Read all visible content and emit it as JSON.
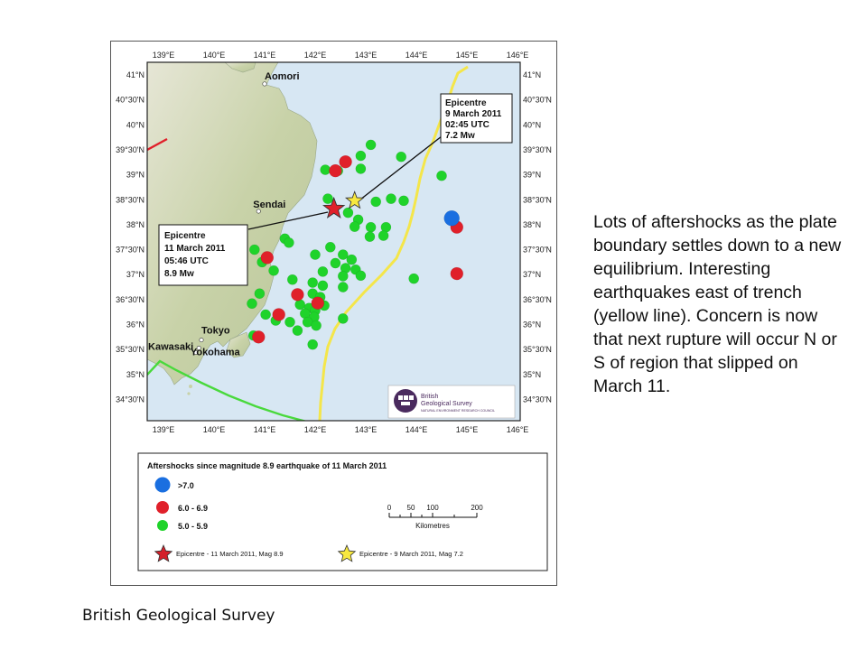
{
  "map": {
    "lon_labels": [
      "139°E",
      "140°E",
      "141°E",
      "142°E",
      "143°E",
      "144°E",
      "145°E",
      "146°E"
    ],
    "lat_labels": [
      "41°N",
      "40°30'N",
      "40°N",
      "39°30'N",
      "39°N",
      "38°30'N",
      "38°N",
      "37°30'N",
      "37°N",
      "36°30'N",
      "36°N",
      "35°30'N",
      "35°N",
      "34°30'N"
    ],
    "cities": [
      {
        "name": "Aomori",
        "lon": 141.0,
        "lat": 40.82
      },
      {
        "name": "Sendai",
        "lon": 140.88,
        "lat": 38.27
      },
      {
        "name": "Tokyo",
        "lon": 139.75,
        "lat": 35.69
      },
      {
        "name": "Yokohama",
        "lon": 139.64,
        "lat": 35.44
      },
      {
        "name": "Kawasaki",
        "lon": 139.7,
        "lat": 35.53
      }
    ],
    "callouts": [
      {
        "lines": [
          "Epicentre",
          "9 March 2011",
          "02:45 UTC",
          "7.2 Mw"
        ]
      },
      {
        "lines": [
          "Epicentre",
          "11 March 2011",
          "05:46 UTC",
          "8.9 Mw"
        ]
      }
    ],
    "epicentres": [
      {
        "name": "11 March 2011",
        "lon": 142.37,
        "lat": 38.32,
        "color": "#e0202a"
      },
      {
        "name": "9 March 2011",
        "lon": 142.78,
        "lat": 38.48,
        "color": "#f7e840"
      }
    ],
    "aftershocks": [
      {
        "lon": 144.7,
        "lat": 38.13,
        "cls": "blue"
      },
      {
        "lon": 144.8,
        "lat": 37.95,
        "cls": "red"
      },
      {
        "lon": 144.8,
        "lat": 37.02,
        "cls": "red"
      },
      {
        "lon": 141.05,
        "lat": 37.34,
        "cls": "red"
      },
      {
        "lon": 142.6,
        "lat": 39.26,
        "cls": "red"
      },
      {
        "lon": 142.4,
        "lat": 39.08,
        "cls": "red"
      },
      {
        "lon": 141.65,
        "lat": 36.6,
        "cls": "red"
      },
      {
        "lon": 142.05,
        "lat": 36.43,
        "cls": "red"
      },
      {
        "lon": 141.28,
        "lat": 36.2,
        "cls": "red"
      },
      {
        "lon": 140.88,
        "lat": 35.75,
        "cls": "red"
      },
      {
        "lon": 143.1,
        "lat": 39.6,
        "cls": "green"
      },
      {
        "lon": 142.9,
        "lat": 39.38,
        "cls": "green"
      },
      {
        "lon": 143.7,
        "lat": 39.36,
        "cls": "green"
      },
      {
        "lon": 142.9,
        "lat": 39.12,
        "cls": "green"
      },
      {
        "lon": 142.2,
        "lat": 39.1,
        "cls": "green"
      },
      {
        "lon": 142.45,
        "lat": 39.08,
        "cls": "green"
      },
      {
        "lon": 142.25,
        "lat": 38.52,
        "cls": "green"
      },
      {
        "lon": 143.2,
        "lat": 38.46,
        "cls": "green"
      },
      {
        "lon": 143.5,
        "lat": 38.52,
        "cls": "green"
      },
      {
        "lon": 143.75,
        "lat": 38.48,
        "cls": "green"
      },
      {
        "lon": 144.5,
        "lat": 38.98,
        "cls": "green"
      },
      {
        "lon": 142.65,
        "lat": 38.24,
        "cls": "green"
      },
      {
        "lon": 142.85,
        "lat": 38.1,
        "cls": "green"
      },
      {
        "lon": 143.4,
        "lat": 37.95,
        "cls": "green"
      },
      {
        "lon": 142.78,
        "lat": 37.96,
        "cls": "green"
      },
      {
        "lon": 143.1,
        "lat": 37.95,
        "cls": "green"
      },
      {
        "lon": 143.35,
        "lat": 37.78,
        "cls": "green"
      },
      {
        "lon": 143.08,
        "lat": 37.76,
        "cls": "green"
      },
      {
        "lon": 141.4,
        "lat": 37.72,
        "cls": "green"
      },
      {
        "lon": 141.48,
        "lat": 37.64,
        "cls": "green"
      },
      {
        "lon": 142.3,
        "lat": 37.55,
        "cls": "green"
      },
      {
        "lon": 142.0,
        "lat": 37.4,
        "cls": "green"
      },
      {
        "lon": 142.55,
        "lat": 37.4,
        "cls": "green"
      },
      {
        "lon": 142.72,
        "lat": 37.3,
        "cls": "green"
      },
      {
        "lon": 142.4,
        "lat": 37.23,
        "cls": "green"
      },
      {
        "lon": 142.6,
        "lat": 37.13,
        "cls": "green"
      },
      {
        "lon": 142.8,
        "lat": 37.1,
        "cls": "green"
      },
      {
        "lon": 142.15,
        "lat": 37.06,
        "cls": "green"
      },
      {
        "lon": 142.55,
        "lat": 36.97,
        "cls": "green"
      },
      {
        "lon": 142.9,
        "lat": 36.98,
        "cls": "green"
      },
      {
        "lon": 143.95,
        "lat": 36.92,
        "cls": "green"
      },
      {
        "lon": 140.8,
        "lat": 37.5,
        "cls": "green"
      },
      {
        "lon": 140.95,
        "lat": 37.25,
        "cls": "green"
      },
      {
        "lon": 141.18,
        "lat": 37.08,
        "cls": "green"
      },
      {
        "lon": 141.55,
        "lat": 36.9,
        "cls": "green"
      },
      {
        "lon": 141.95,
        "lat": 36.84,
        "cls": "green"
      },
      {
        "lon": 142.15,
        "lat": 36.78,
        "cls": "green"
      },
      {
        "lon": 142.55,
        "lat": 36.75,
        "cls": "green"
      },
      {
        "lon": 140.9,
        "lat": 36.62,
        "cls": "green"
      },
      {
        "lon": 141.95,
        "lat": 36.62,
        "cls": "green"
      },
      {
        "lon": 142.1,
        "lat": 36.55,
        "cls": "green"
      },
      {
        "lon": 140.75,
        "lat": 36.42,
        "cls": "green"
      },
      {
        "lon": 141.7,
        "lat": 36.4,
        "cls": "green"
      },
      {
        "lon": 141.88,
        "lat": 36.33,
        "cls": "green"
      },
      {
        "lon": 142.0,
        "lat": 36.28,
        "cls": "green"
      },
      {
        "lon": 142.18,
        "lat": 36.38,
        "cls": "green"
      },
      {
        "lon": 141.8,
        "lat": 36.22,
        "cls": "green"
      },
      {
        "lon": 141.98,
        "lat": 36.15,
        "cls": "green"
      },
      {
        "lon": 142.55,
        "lat": 36.12,
        "cls": "green"
      },
      {
        "lon": 141.02,
        "lat": 36.2,
        "cls": "green"
      },
      {
        "lon": 141.22,
        "lat": 36.08,
        "cls": "green"
      },
      {
        "lon": 141.5,
        "lat": 36.05,
        "cls": "green"
      },
      {
        "lon": 141.85,
        "lat": 36.05,
        "cls": "green"
      },
      {
        "lon": 142.02,
        "lat": 35.98,
        "cls": "green"
      },
      {
        "lon": 141.65,
        "lat": 35.88,
        "cls": "green"
      },
      {
        "lon": 140.78,
        "lat": 35.78,
        "cls": "green"
      },
      {
        "lon": 141.95,
        "lat": 35.6,
        "cls": "green"
      }
    ],
    "legend": {
      "title": "Aftershocks since magnitude 8.9 earthquake of 11 March 2011",
      "items": [
        {
          "label": ">7.0",
          "color": "#1a6fe0"
        },
        {
          "label": "6.0 - 6.9",
          "color": "#e0202a"
        },
        {
          "label": "5.0 - 5.9",
          "color": "#1fd32a"
        }
      ],
      "epicentres": [
        {
          "label": "Epicentre - 11 March 2011, Mag 8.9",
          "color": "#d4202a"
        },
        {
          "label": "Epicentre - 9 March 2011, Mag 7.2",
          "color": "#f7e840"
        }
      ],
      "scale_ticks": [
        "0",
        "50",
        "100",
        "200"
      ],
      "scale_unit": "Kilometres"
    },
    "logo": {
      "line1": "British",
      "line2": "Geological Survey",
      "line3": "NATURAL ENVIRONMENT RESEARCH COUNCIL"
    },
    "colors": {
      "sea": "#d7e7f3",
      "land": "#cfd6b4",
      "trench": "#f4e64a",
      "boundary": "#49d93c",
      "border_red": "#e0202a"
    }
  },
  "side_note": "Lots of aftershocks as the plate boundary settles down to a new equilibrium. Interesting earthquakes east of trench (yellow line). Concern is now that next rupture will occur N or S of region that slipped on March 11.",
  "credit": "British Geological Survey"
}
